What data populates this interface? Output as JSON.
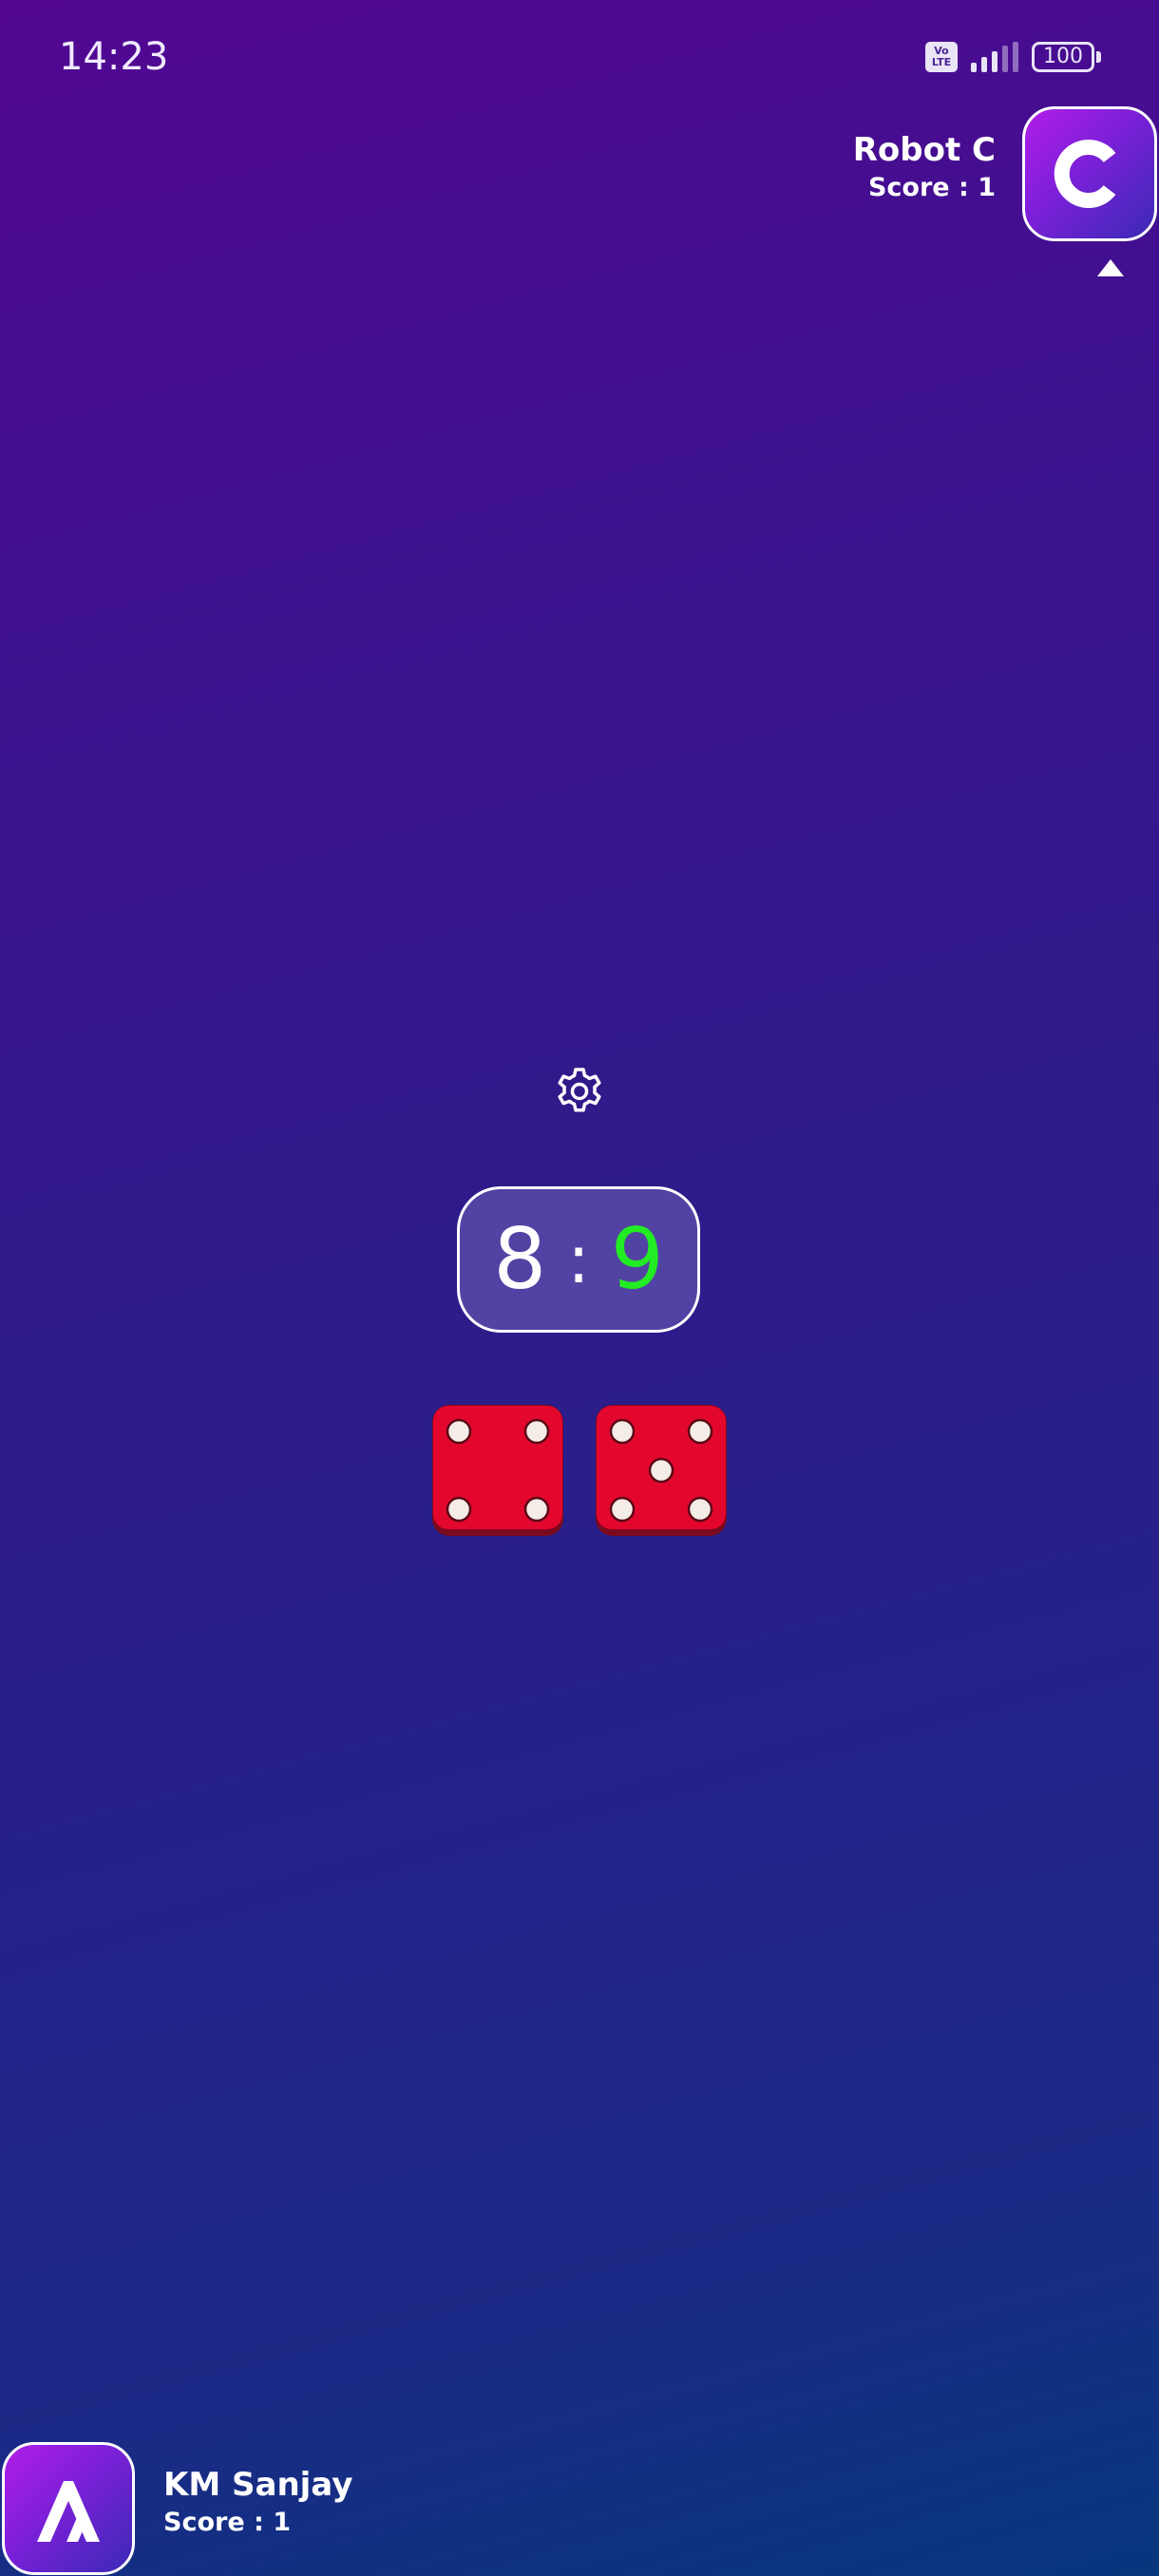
{
  "status_bar": {
    "time": "14:23",
    "volte_top": "Vo",
    "volte_bottom": "LTE",
    "battery": "100"
  },
  "opponent": {
    "name": "Robot C",
    "score_label": "Score : 1",
    "avatar_letter": "C",
    "is_current_turn": true
  },
  "player": {
    "name": "KM Sanjay",
    "score_label": "Score : 1",
    "avatar_icon": "stylized-a-icon"
  },
  "scoreboard": {
    "left": "8",
    "separator": ":",
    "right": "9",
    "right_color": "#22ec23"
  },
  "dice": [
    {
      "value": 4,
      "color": "#e8062e"
    },
    {
      "value": 5,
      "color": "#e8062e"
    }
  ],
  "icons": {
    "settings": "gear-icon"
  }
}
